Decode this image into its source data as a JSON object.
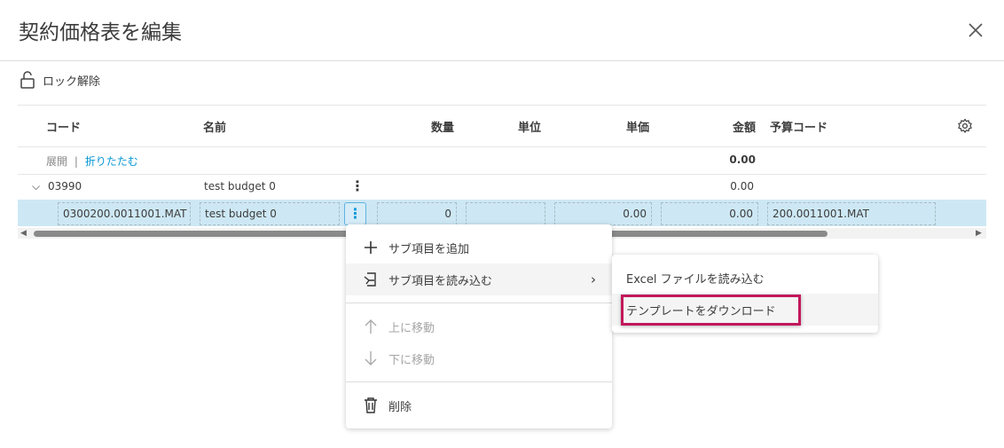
{
  "dialog": {
    "title": "契約価格表を編集",
    "close_icon": "close-icon"
  },
  "toolbar": {
    "unlock_label": "ロック解除"
  },
  "table": {
    "headers": {
      "code": "コード",
      "name": "名前",
      "quantity": "数量",
      "unit": "単位",
      "unit_price": "単価",
      "amount": "金額",
      "budget_code": "予算コード"
    },
    "expand": "展開",
    "separator": "|",
    "collapse": "折りたたむ",
    "total_amount": "0.00",
    "rows": [
      {
        "code": "03990",
        "name": "test budget 0",
        "amount": "0.00"
      },
      {
        "code": "0300200.0011001.MAT",
        "name": "test budget 0",
        "quantity": "0",
        "unit": "",
        "unit_price": "0.00",
        "amount": "0.00",
        "budget_code": "200.0011001.MAT"
      }
    ]
  },
  "context_menu": {
    "add_sub": "サブ項目を追加",
    "import_sub": "サブ項目を読み込む",
    "move_up": "上に移動",
    "move_down": "下に移動",
    "delete": "削除"
  },
  "submenu": {
    "import_excel": "Excel ファイルを読み込む",
    "download_template": "テンプレートをダウンロード"
  },
  "colors": {
    "selected_row": "#cde8f4",
    "link": "#0696d7",
    "highlight": "#c2185b"
  }
}
